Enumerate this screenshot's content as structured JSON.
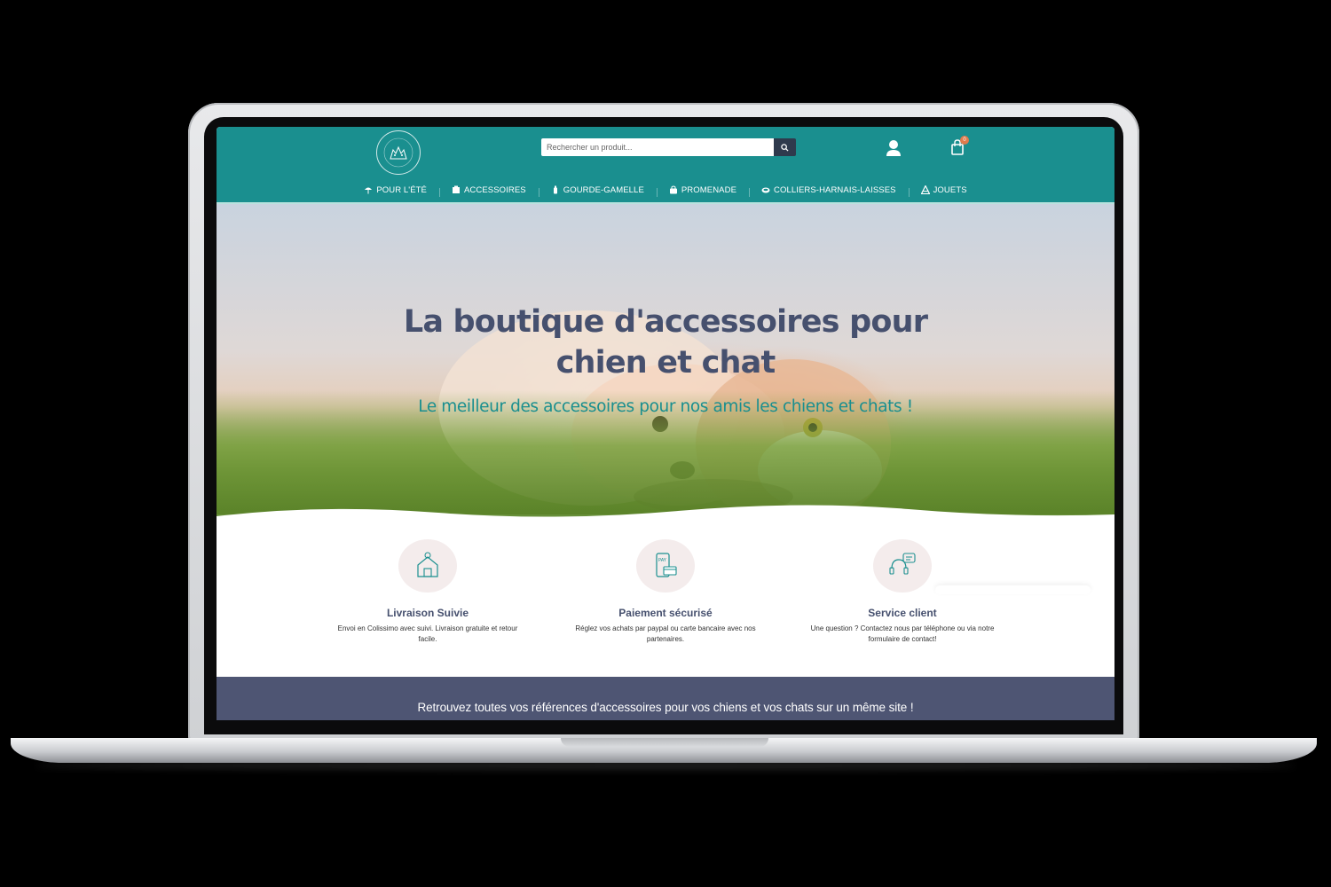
{
  "header": {
    "search": {
      "placeholder": "Rechercher un produit..."
    },
    "cart": {
      "count": "0"
    }
  },
  "nav": {
    "items": [
      {
        "label": "POUR L'ÉTÉ",
        "icon": "umbrella-icon"
      },
      {
        "label": "ACCESSOIRES",
        "icon": "accessories-icon"
      },
      {
        "label": "GOURDE-GAMELLE",
        "icon": "bottle-icon"
      },
      {
        "label": "PROMENADE",
        "icon": "bag-icon"
      },
      {
        "label": "COLLIERS-HARNAIS-LAISSES",
        "icon": "collar-icon"
      },
      {
        "label": "JOUETS",
        "icon": "toy-icon"
      }
    ]
  },
  "hero": {
    "title_line1": "La boutique d'accessoires pour",
    "title_line2": "chien et chat",
    "subtitle": "Le meilleur des accessoires pour nos amis les chiens et chats !"
  },
  "features": [
    {
      "title": "Livraison Suivie",
      "text": "Envoi en Colissimo avec suivi. Livraison gratuite et retour facile.",
      "icon": "house-location-icon"
    },
    {
      "title": "Paiement sécurisé",
      "text": "Réglez vos achats par paypal ou carte bancaire avec nos partenaires.",
      "icon": "phone-pay-icon"
    },
    {
      "title": "Service client",
      "text": "Une question ? Contactez nous par téléphone ou via notre formulaire de contact!",
      "icon": "headset-chat-icon"
    }
  ],
  "band": {
    "text": "Retrouvez toutes vos références d'accessoires pour vos chiens et vos chats sur un même site !"
  },
  "colors": {
    "header": "#1a8f8f",
    "title": "#46506e",
    "band": "#4e5573",
    "badge": "#e07b4d"
  }
}
